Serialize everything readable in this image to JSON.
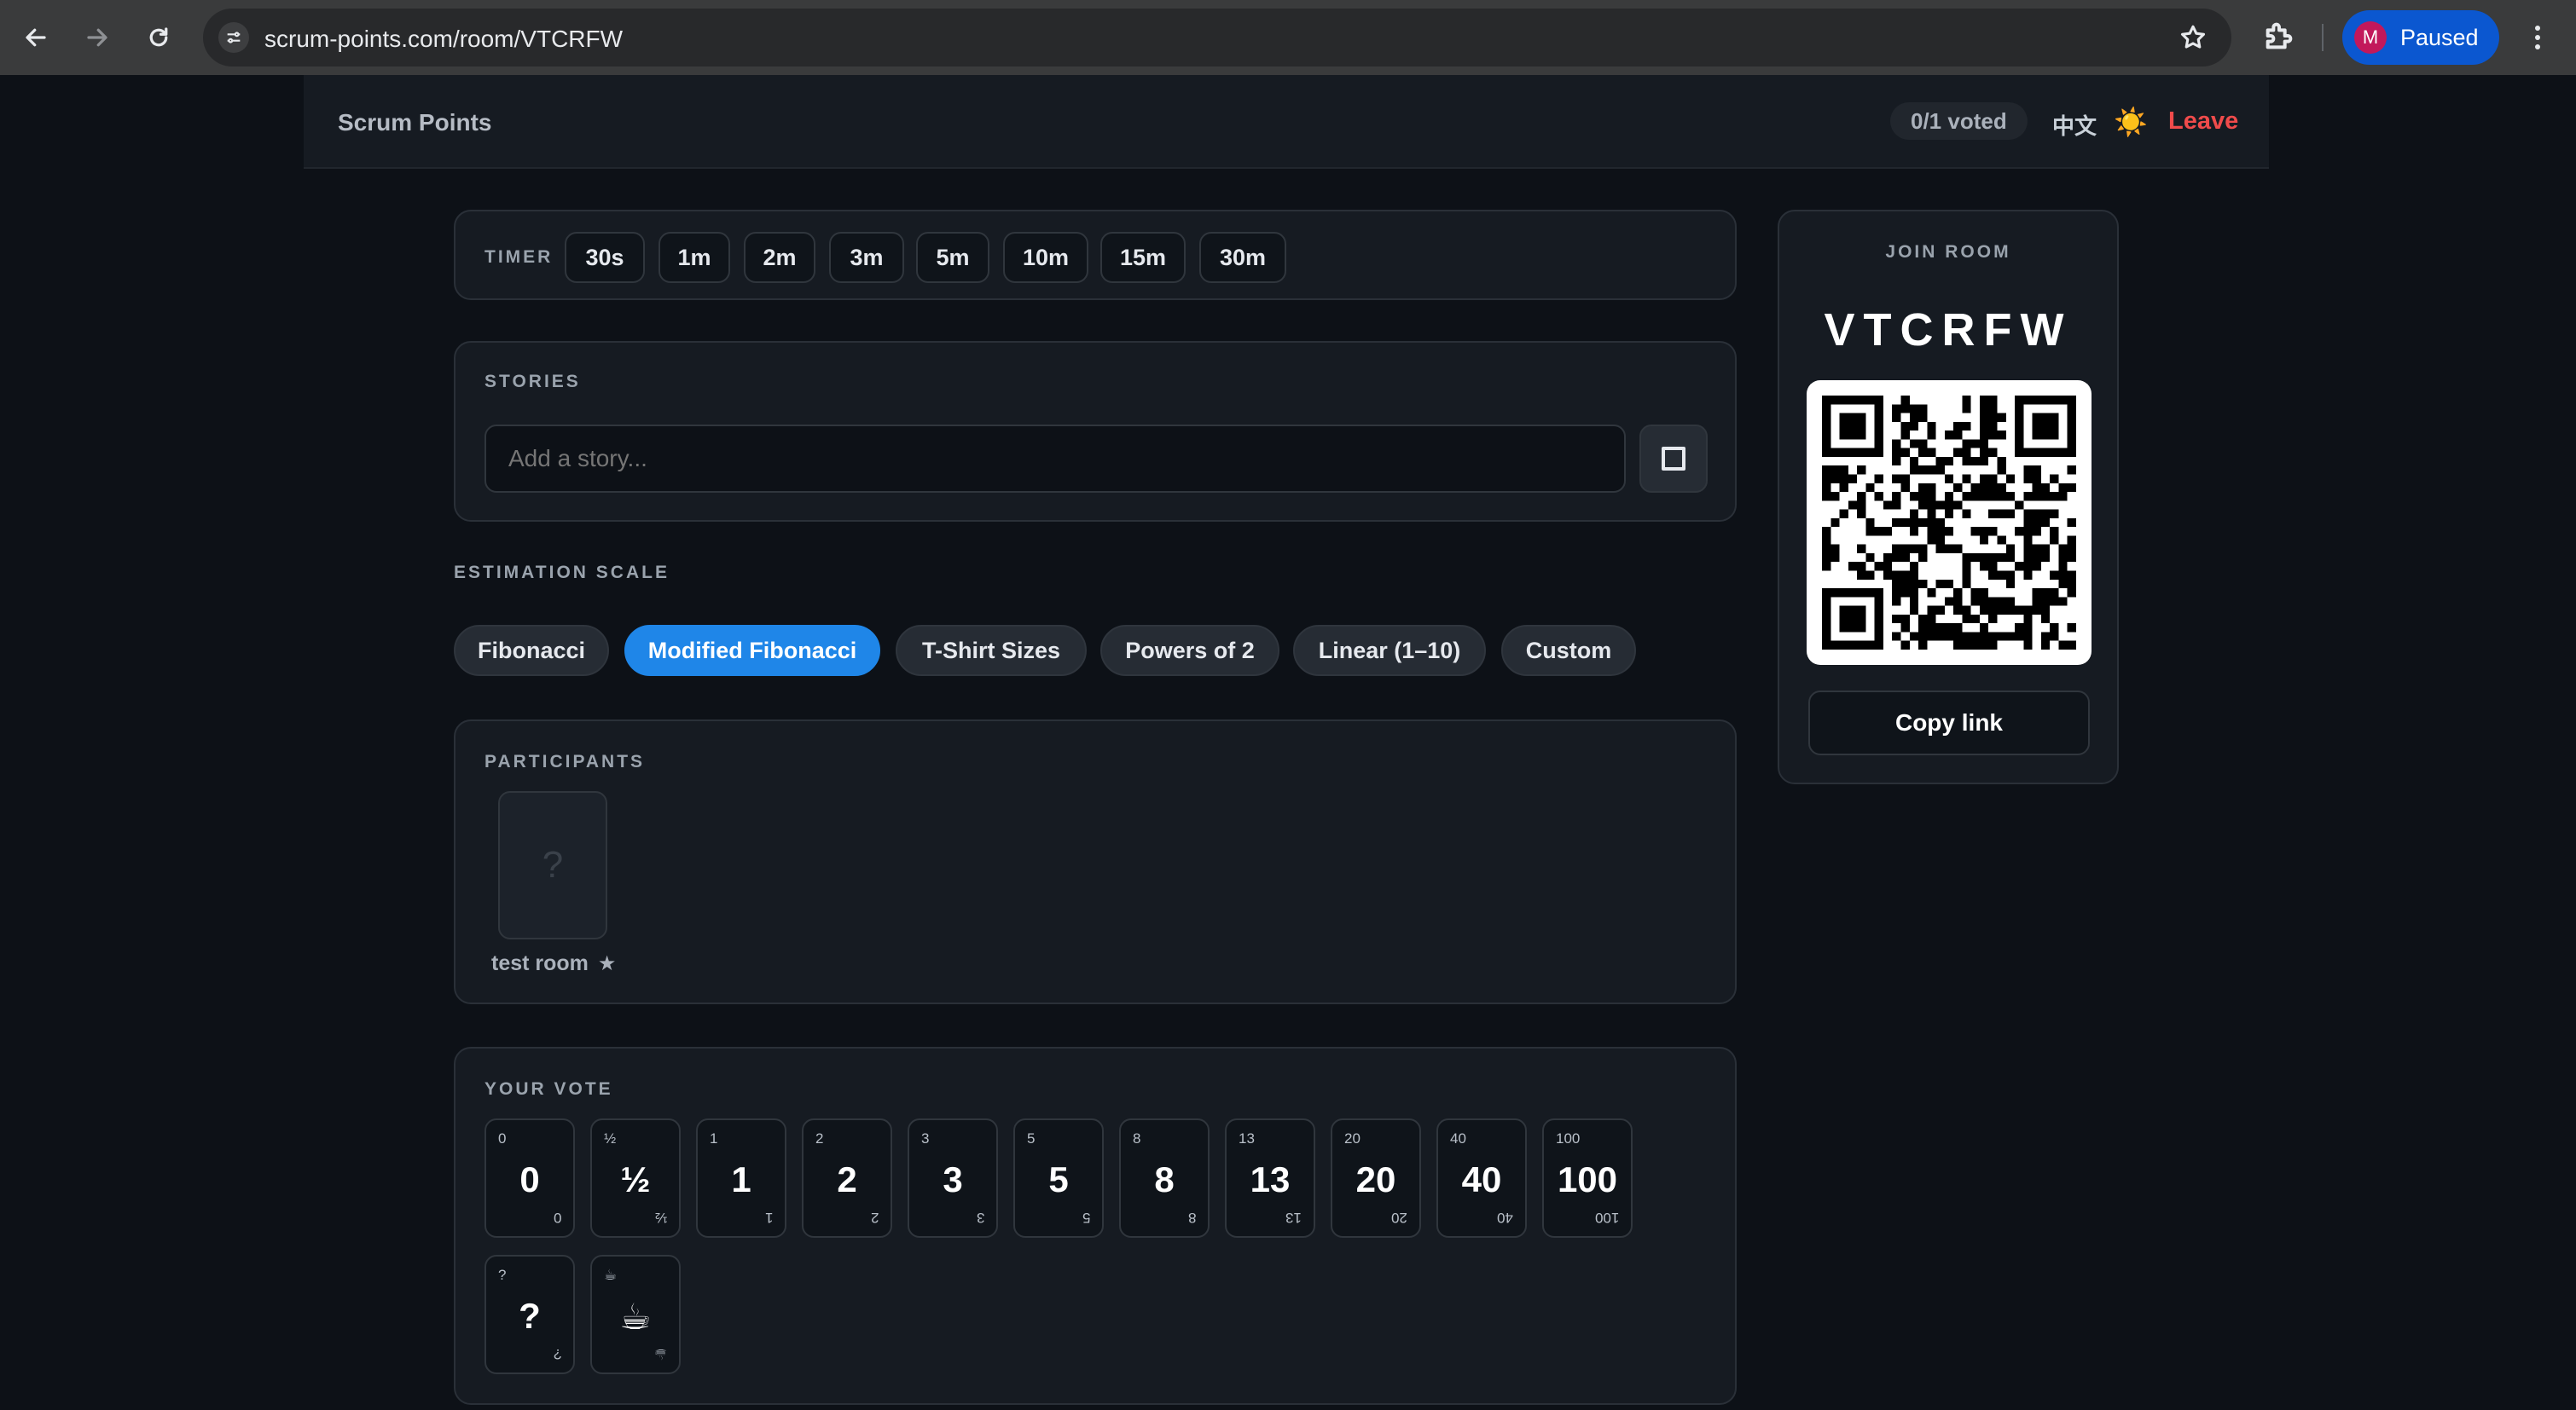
{
  "browser": {
    "url": "scrum-points.com/room/VTCRFW",
    "profile_initial": "M",
    "profile_status": "Paused"
  },
  "header": {
    "brand": "Scrum Points",
    "voted": "0/1 voted",
    "language": "中文",
    "theme_icon": "☀️",
    "leave": "Leave"
  },
  "timer": {
    "label": "TIMER",
    "options": [
      "30s",
      "1m",
      "2m",
      "3m",
      "5m",
      "10m",
      "15m",
      "30m"
    ]
  },
  "stories": {
    "label": "STORIES",
    "placeholder": "Add a story..."
  },
  "scale": {
    "label": "ESTIMATION SCALE",
    "options": [
      "Fibonacci",
      "Modified Fibonacci",
      "T-Shirt Sizes",
      "Powers of 2",
      "Linear (1–10)",
      "Custom"
    ],
    "active": "Modified Fibonacci"
  },
  "participants": {
    "label": "PARTICIPANTS",
    "items": [
      {
        "card": "?",
        "name": "test room",
        "badge": "★"
      }
    ]
  },
  "vote": {
    "label": "YOUR VOTE",
    "cards": [
      "0",
      "½",
      "1",
      "2",
      "3",
      "5",
      "8",
      "13",
      "20",
      "40",
      "100",
      "?",
      "☕"
    ]
  },
  "join": {
    "label": "JOIN ROOM",
    "code": "VTCRFW",
    "copy": "Copy link"
  },
  "colors": {
    "accent": "#1f86e8",
    "leave": "#f04b4b",
    "background": "#0d1117",
    "panel": "#161b22"
  }
}
